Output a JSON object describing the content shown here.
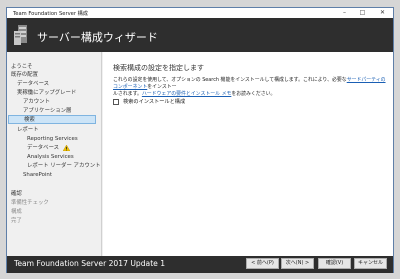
{
  "window": {
    "title": "Team Foundation Server 構成"
  },
  "header": {
    "title": "サーバー構成ウィザード"
  },
  "sidebar": {
    "items": [
      {
        "label": "ようこそ"
      },
      {
        "label": "既存の配置"
      },
      {
        "label": "データベース"
      },
      {
        "label": "実稼働にアップグレード"
      },
      {
        "label": "アカウント"
      },
      {
        "label": "アプリケーション層"
      },
      {
        "label": "検索"
      },
      {
        "label": "レポート"
      },
      {
        "label": "Reporting Services"
      },
      {
        "label": "データベース"
      },
      {
        "label": "Analysis Services"
      },
      {
        "label": "レポート リーダー アカウント"
      },
      {
        "label": "SharePoint"
      },
      {
        "label": "確認"
      },
      {
        "label": "準備性チェック"
      },
      {
        "label": "構成"
      },
      {
        "label": "完了"
      }
    ]
  },
  "main": {
    "title": "検索構成の設定を指定します",
    "desc_line1_a": "これらの設定を使用して、オプションの Search 機能をインストールして構成します。これにより、必要な",
    "desc_link1": "サードパーティのコンポーネント",
    "desc_line1_b": "をインストー",
    "desc_line2_a": "ルされます。",
    "desc_link2": "ハードウェアの要件とインストール メモ",
    "desc_line2_b": "をお読みください。",
    "checkbox_label": "検索のインストールと構成"
  },
  "footer": {
    "product": "Team Foundation Server 2017 Update 1",
    "back_label": "< 前へ(P)",
    "next_label": "次へ(N) >",
    "verify_label": "確認(V)",
    "cancel_label": "キャンセル"
  }
}
